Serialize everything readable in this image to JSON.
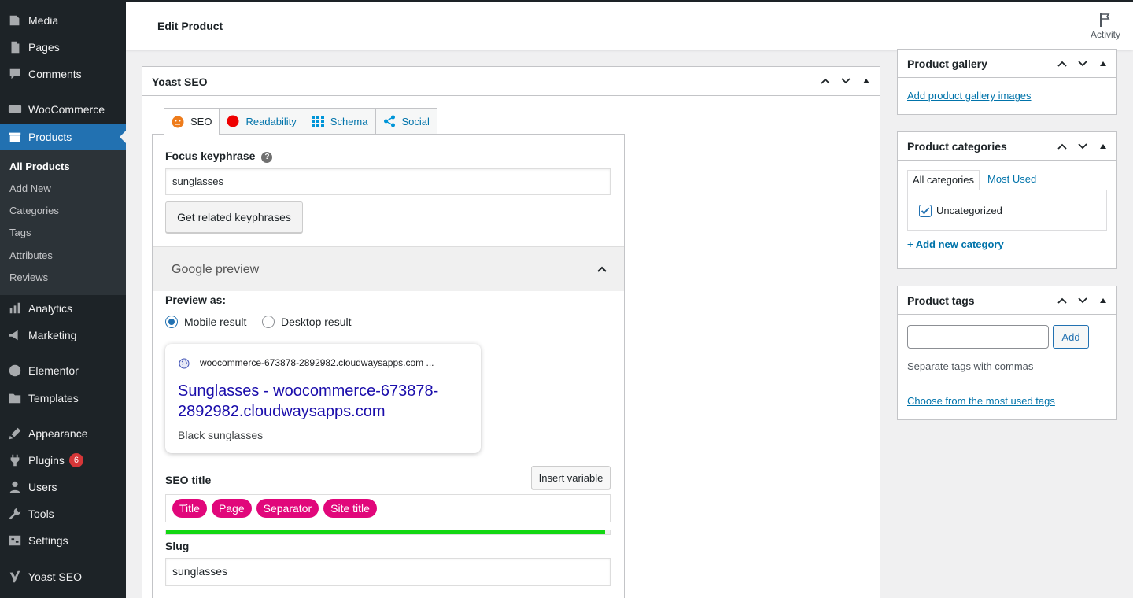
{
  "colors": {
    "sidebar_bg": "#1d2327",
    "submenu_bg": "#2c3338",
    "active_menu": "#2271b1",
    "link": "#0073aa",
    "pill": "#e1077b",
    "progress": "#13d713",
    "google_title": "#1a0dab"
  },
  "sidebar": {
    "items": [
      {
        "label": "Media",
        "icon": "media-icon"
      },
      {
        "label": "Pages",
        "icon": "pages-icon"
      },
      {
        "label": "Comments",
        "icon": "comments-icon"
      },
      {
        "label": "WooCommerce",
        "icon": "woocommerce-icon"
      },
      {
        "label": "Products",
        "icon": "products-icon",
        "active": true
      },
      {
        "label": "Analytics",
        "icon": "analytics-icon"
      },
      {
        "label": "Marketing",
        "icon": "marketing-icon"
      },
      {
        "label": "Elementor",
        "icon": "elementor-icon"
      },
      {
        "label": "Templates",
        "icon": "templates-icon"
      },
      {
        "label": "Appearance",
        "icon": "appearance-icon"
      },
      {
        "label": "Plugins",
        "icon": "plugins-icon",
        "badge": "6"
      },
      {
        "label": "Users",
        "icon": "users-icon"
      },
      {
        "label": "Tools",
        "icon": "tools-icon"
      },
      {
        "label": "Settings",
        "icon": "settings-icon"
      },
      {
        "label": "Yoast SEO",
        "icon": "yoast-icon"
      }
    ],
    "submenu": [
      "All Products",
      "Add New",
      "Categories",
      "Tags",
      "Attributes",
      "Reviews"
    ]
  },
  "header": {
    "title": "Edit Product",
    "activity": "Activity"
  },
  "yoast": {
    "title": "Yoast SEO",
    "tabs": [
      "SEO",
      "Readability",
      "Schema",
      "Social"
    ],
    "focus_label": "Focus keyphrase",
    "focus_value": "sunglasses",
    "related_button": "Get related keyphrases",
    "google_preview": "Google preview",
    "preview_as": "Preview as:",
    "mobile_result": "Mobile result",
    "desktop_result": "Desktop result",
    "preview": {
      "url": "woocommerce-673878-2892982.cloudwaysapps.com ...",
      "title": "Sunglasses - woocommerce-673878-2892982.cloudwaysapps.com",
      "description": "Black sunglasses"
    },
    "seo_title_label": "SEO title",
    "insert_variable": "Insert variable",
    "variables": [
      "Title",
      "Page",
      "Separator",
      "Site title"
    ],
    "title_progress": 0.99,
    "slug_label": "Slug",
    "slug_value": "sunglasses"
  },
  "gallery": {
    "title": "Product gallery",
    "link": "Add product gallery images"
  },
  "categories": {
    "title": "Product categories",
    "tab_all": "All categories",
    "tab_used": "Most Used",
    "item": "Uncategorized",
    "add_link": "+ Add new category"
  },
  "tags": {
    "title": "Product tags",
    "add_button": "Add",
    "hint": "Separate tags with commas",
    "choose_link": "Choose from the most used tags"
  }
}
